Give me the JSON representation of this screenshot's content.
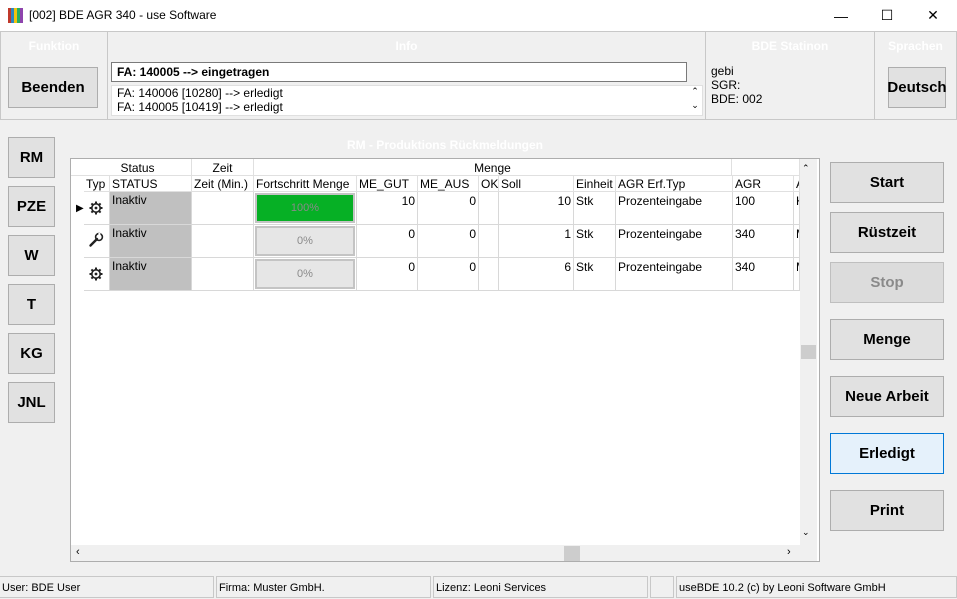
{
  "window": {
    "title": "[002] BDE AGR 340 - use Software",
    "min_glyph": "—",
    "max_glyph": "☐",
    "close_glyph": "✕"
  },
  "top": {
    "funktion": {
      "title": "Funktion",
      "button": "Beenden"
    },
    "info": {
      "title": "Info",
      "current": "FA: 140005 --> eingetragen",
      "lines": [
        "FA: 140006 [10280] --> erledigt",
        "FA: 140005 [10419] --> erledigt"
      ]
    },
    "station": {
      "title": "BDE Statinon",
      "lines": [
        "gebi",
        "SGR:",
        "BDE: 002"
      ]
    },
    "sprachen": {
      "title": "Sprachen",
      "button": "Deutsch"
    }
  },
  "nav": [
    "RM",
    "PZE",
    "W",
    "T",
    "KG",
    "JNL"
  ],
  "section_title": "RM - Produktions Rückmeldungen",
  "grid": {
    "group_headers": {
      "status": "Status",
      "zeit": "Zeit",
      "menge": "Menge"
    },
    "columns": [
      "Typ",
      "STATUS",
      "Zeit (Min.)",
      "Fortschritt Menge",
      "ME_GUT",
      "ME_AUS",
      "OK",
      "Soll",
      "Einheit",
      "AGR Erf.Typ",
      "AGR",
      "A"
    ],
    "rows": [
      {
        "typ_icon": "gear-icon",
        "status": "Inaktiv",
        "zeit": "",
        "progress": 100,
        "progress_label": "100%",
        "me_gut": "10",
        "me_aus": "0",
        "ok": "",
        "soll": "10",
        "einheit": "Stk",
        "erf_typ": "Prozenteingabe",
        "agr": "100",
        "a": "K",
        "current": true
      },
      {
        "typ_icon": "wrench-icon",
        "status": "Inaktiv",
        "zeit": "",
        "progress": 0,
        "progress_label": "0%",
        "me_gut": "0",
        "me_aus": "0",
        "ok": "",
        "soll": "1",
        "einheit": "Stk",
        "erf_typ": "Prozenteingabe",
        "agr": "340",
        "a": "M",
        "current": false
      },
      {
        "typ_icon": "gear-icon",
        "status": "Inaktiv",
        "zeit": "",
        "progress": 0,
        "progress_label": "0%",
        "me_gut": "0",
        "me_aus": "0",
        "ok": "",
        "soll": "6",
        "einheit": "Stk",
        "erf_typ": "Prozenteingabe",
        "agr": "340",
        "a": "M",
        "current": false
      }
    ]
  },
  "actions": {
    "start": "Start",
    "ruestzeit": "Rüstzeit",
    "stop": "Stop",
    "menge": "Menge",
    "neue_arbeit": "Neue Arbeit",
    "erledigt": "Erledigt",
    "print": "Print"
  },
  "statusbar": {
    "user": "User: BDE User",
    "firma": "Firma: Muster GmbH.",
    "lizenz": "Lizenz: Leoni Services",
    "empty": "",
    "version": "useBDE 10.2 (c) by Leoni Software GmbH"
  },
  "colors": {
    "progress_fill": "#06b025",
    "status_cell": "#c0c0c0",
    "focus_border": "#0078d7"
  }
}
